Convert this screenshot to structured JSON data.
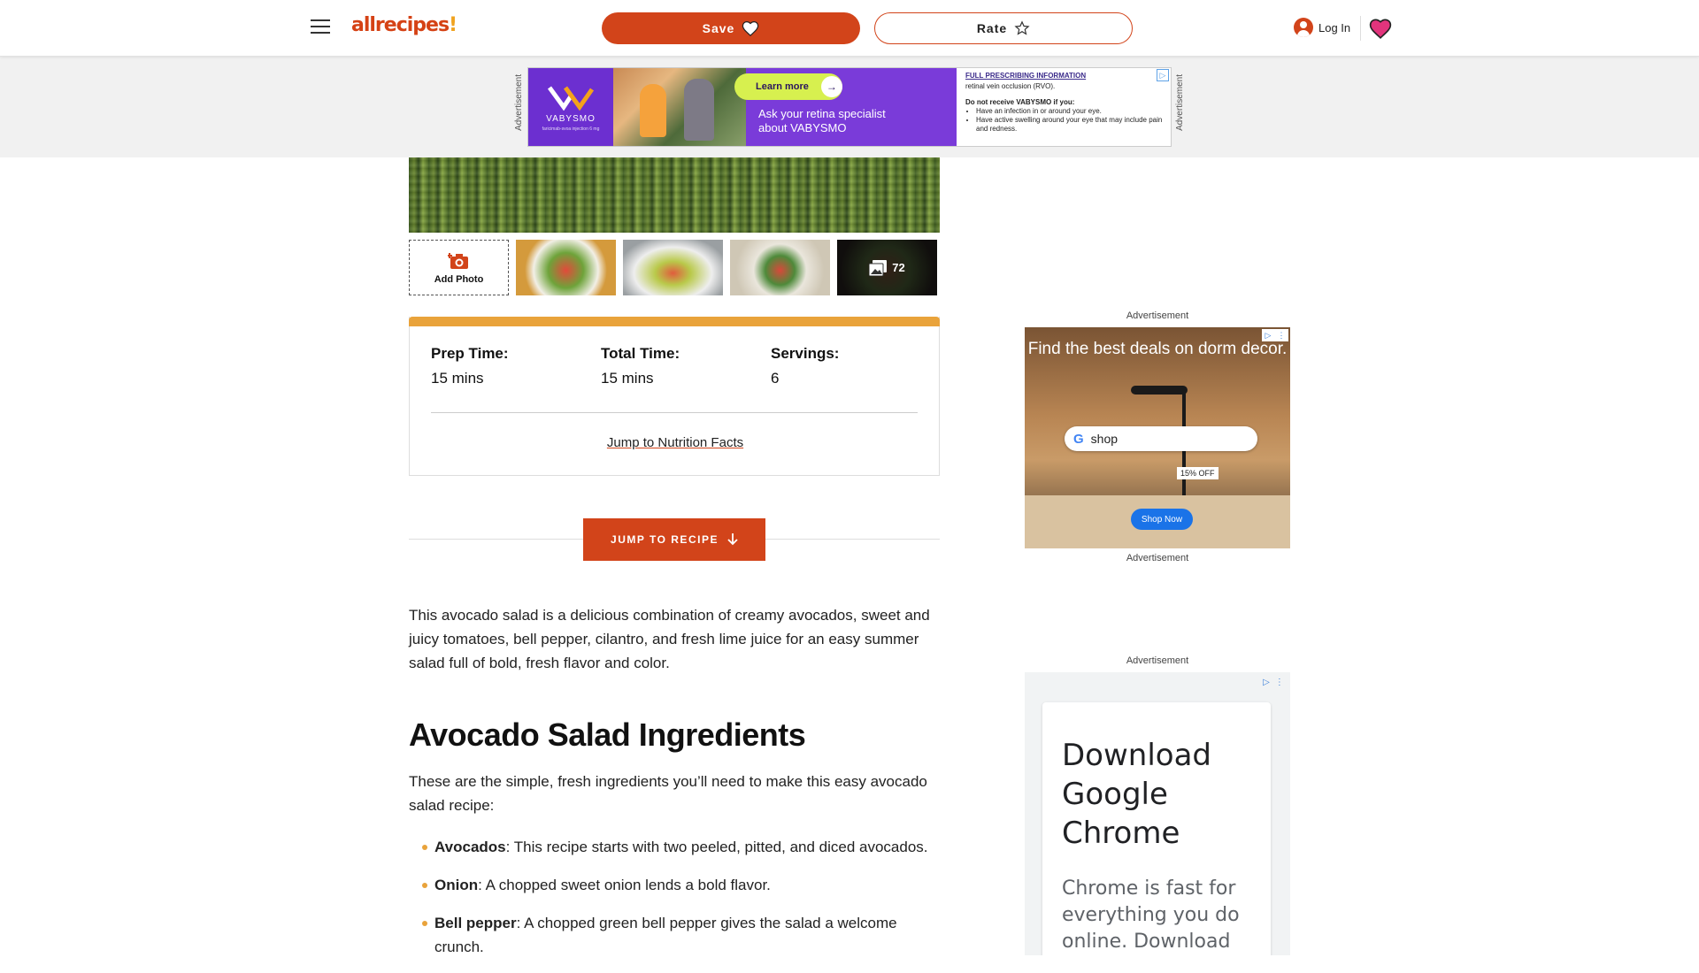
{
  "header": {
    "logo": "allrecipes",
    "logo_mark": "!",
    "save_label": "Save",
    "rate_label": "Rate",
    "login_label": "Log In"
  },
  "ads": {
    "label": "Advertisement",
    "banner": {
      "brand": "VABYSMO",
      "brand_sub": "faricimab-svoa injection 6 mg",
      "cta": "Learn more",
      "headline": "Ask your retina specialist about VABYSMO",
      "isi_heading": "FULL PRESCRIBING INFORMATION",
      "isi_line": "retinal vein occlusion (RVO).",
      "isi_bold": "Do not receive VABYSMO if you:",
      "isi_items": [
        "Have an infection in or around your eye.",
        "Have active swelling around your eye that may include pain and redness."
      ]
    },
    "dorm": {
      "headline": "Find the best deals on dorm decor.",
      "search_text": "shop",
      "discount": "15% OFF",
      "cta": "Shop Now"
    },
    "chrome": {
      "title": "Download Google Chrome",
      "desc": "Chrome is fast for everything you do online. Download"
    }
  },
  "gallery": {
    "add_photo": "Add Photo",
    "photo_count": "72"
  },
  "details": {
    "prep_label": "Prep Time:",
    "prep_value": "15 mins",
    "total_label": "Total Time:",
    "total_value": "15 mins",
    "servings_label": "Servings:",
    "servings_value": "6",
    "nutrition_link": "Jump to Nutrition Facts"
  },
  "jump_to_recipe": "JUMP TO RECIPE",
  "article": {
    "intro": "This avocado salad is a delicious combination of creamy avocados, sweet and juicy tomatoes, bell pepper, cilantro, and fresh lime juice for an easy summer salad full of bold, fresh flavor and color.",
    "heading": "Avocado Salad Ingredients",
    "para": "These are the simple, fresh ingredients you’ll need to make this easy avocado salad recipe:",
    "ingredients": [
      {
        "name": "Avocados",
        "text": ": This recipe starts with two peeled, pitted, and diced avocados."
      },
      {
        "name": "Onion",
        "text": ": A chopped sweet onion lends a bold flavor."
      },
      {
        "name": "Bell pepper",
        "text": ": A chopped green bell pepper gives the salad a welcome crunch."
      }
    ]
  },
  "colors": {
    "brand": "#d2441a",
    "accent": "#e9a33b"
  }
}
